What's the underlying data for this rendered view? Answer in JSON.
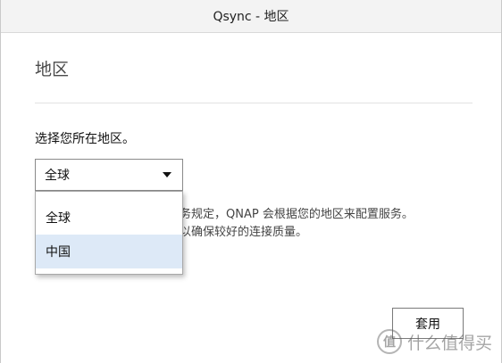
{
  "window": {
    "title": "Qsync - 地区"
  },
  "page": {
    "heading": "地区",
    "prompt": "选择您所在地区。",
    "description_line1": "务规定，QNAP 会根据您的地区来配置服务。",
    "description_line2": "以确保较好的连接质量。"
  },
  "region_select": {
    "selected": "全球",
    "options": [
      "全球",
      "中国"
    ],
    "hovered_option": "中国"
  },
  "actions": {
    "apply_label": "套用"
  },
  "watermark": {
    "logo_text": "值",
    "text": "什么值得买"
  },
  "colors": {
    "titlebar_bg": "#f3f3f3",
    "option_hover_bg": "#dde9f7"
  }
}
